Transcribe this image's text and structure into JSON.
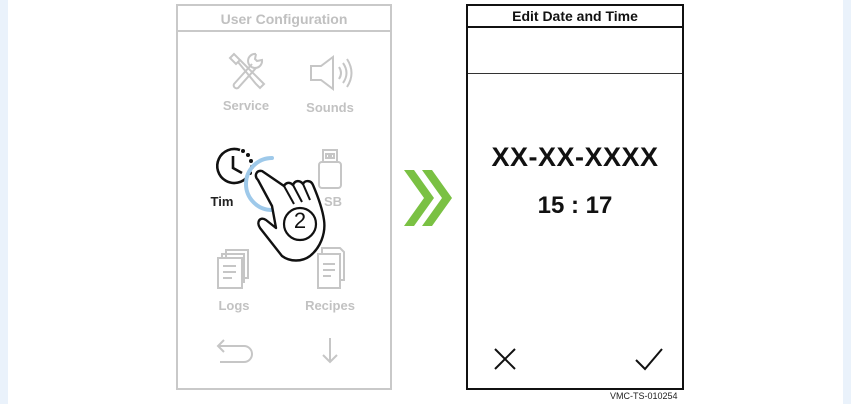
{
  "left_screen": {
    "title": "User Configuration",
    "tiles": [
      {
        "label": "Service",
        "icon": "tools-icon"
      },
      {
        "label": "Sounds",
        "icon": "speaker-icon"
      },
      {
        "label": "Time",
        "icon": "clock-icon"
      },
      {
        "label": "USB",
        "icon": "usb-icon"
      },
      {
        "label": "Logs",
        "icon": "logs-icon"
      },
      {
        "label": "Recipes",
        "icon": "recipes-icon"
      }
    ],
    "nav": {
      "back_icon": "back-arrow-icon",
      "down_icon": "down-arrow-icon"
    },
    "time_label_visible": "Tim",
    "usb_label_visible": "SB"
  },
  "gesture": {
    "step_number": "2",
    "icon": "pointing-hand-icon"
  },
  "transition_icon": "double-chevron-right-icon",
  "right_screen": {
    "title": "Edit Date and Time",
    "date_value": "XX-XX-XXXX",
    "time_value": "15 : 17",
    "cancel_icon": "close-icon",
    "confirm_icon": "checkmark-icon"
  },
  "reference_code": "VMC-TS-010254",
  "colors": {
    "page_background": "#eaf2fb",
    "inactive_gray": "#c2c2c2",
    "accent_green": "#7ac143",
    "touch_ring_blue": "#9ec9ea"
  }
}
